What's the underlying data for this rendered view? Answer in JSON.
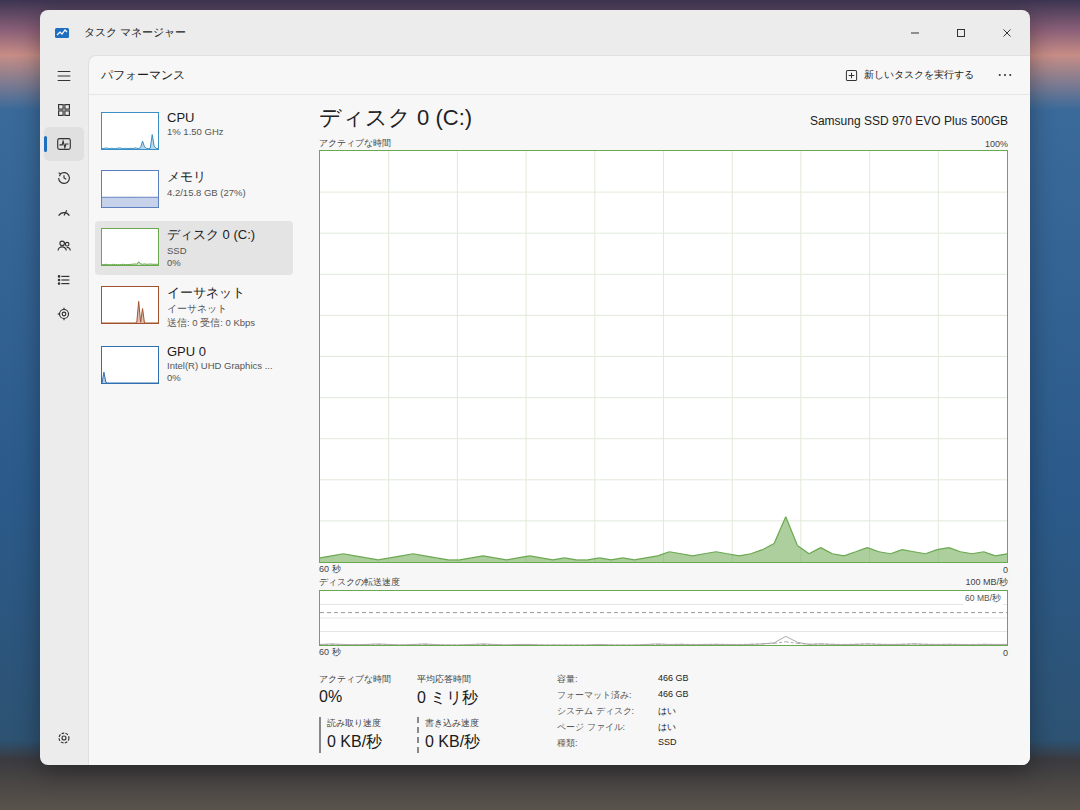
{
  "window": {
    "title": "タスク マネージャー"
  },
  "nav": [
    {
      "kind": "menu",
      "selected": false
    },
    {
      "kind": "processes",
      "selected": false
    },
    {
      "kind": "performance",
      "selected": true
    },
    {
      "kind": "history",
      "selected": false
    },
    {
      "kind": "startup",
      "selected": false
    },
    {
      "kind": "users",
      "selected": false
    },
    {
      "kind": "details",
      "selected": false
    },
    {
      "kind": "services",
      "selected": false
    },
    {
      "kind": "settings",
      "selected": false
    }
  ],
  "header": {
    "title": "パフォーマンス",
    "run_task": "新しいタスクを実行する"
  },
  "devices": [
    {
      "name": "CPU",
      "lines": [
        "1% 1.50 GHz"
      ],
      "selected": false,
      "color": "#3b8fc4",
      "max_value": 100,
      "values": [
        2,
        1,
        3,
        2,
        1,
        2,
        1,
        1,
        2,
        3,
        2,
        1,
        2,
        1,
        1,
        2,
        1,
        3,
        2,
        1,
        4,
        22,
        6,
        2,
        1,
        2,
        40,
        8,
        2,
        1
      ]
    },
    {
      "name": "メモリ",
      "lines": [
        "4.2/15.8 GB (27%)"
      ],
      "selected": false,
      "color": "#5b7fbf",
      "max_value": 100,
      "values": [
        27,
        27,
        27,
        27,
        27,
        27,
        27,
        27,
        27,
        27,
        27,
        27,
        27,
        27,
        27,
        27,
        27,
        27,
        27,
        27,
        27,
        27,
        27,
        27,
        27,
        27,
        27,
        27,
        27,
        27
      ]
    },
    {
      "name": "ディスク 0 (C:)",
      "lines": [
        "SSD",
        "0%"
      ],
      "selected": true,
      "color": "#6aa84f",
      "max_value": 100,
      "values": [
        1,
        1,
        2,
        1,
        1,
        1,
        2,
        1,
        1,
        1,
        1,
        2,
        1,
        1,
        1,
        2,
        2,
        3,
        2,
        9,
        3,
        2,
        3,
        2,
        2,
        3,
        2,
        2,
        2,
        2
      ]
    },
    {
      "name": "イーサネット",
      "lines": [
        "イーサネット",
        "送信: 0 受信: 0 Kbps"
      ],
      "selected": false,
      "color": "#a0522d",
      "max_value": 100,
      "values": [
        0,
        0,
        0,
        0,
        0,
        0,
        0,
        0,
        0,
        0,
        0,
        0,
        0,
        0,
        0,
        0,
        0,
        0,
        1,
        60,
        2,
        40,
        0,
        0,
        0,
        0,
        0,
        0,
        0,
        0
      ]
    },
    {
      "name": "GPU 0",
      "lines": [
        "Intel(R) UHD Graphics ...",
        "0%"
      ],
      "selected": false,
      "color": "#2f6fb0",
      "max_value": 100,
      "values": [
        0,
        30,
        2,
        0,
        0,
        0,
        0,
        0,
        0,
        0,
        0,
        0,
        0,
        0,
        0,
        0,
        0,
        0,
        0,
        0,
        0,
        0,
        0,
        0,
        0,
        0,
        0,
        0,
        0,
        0
      ]
    }
  ],
  "detail": {
    "title": "ディスク 0 (C:)",
    "model": "Samsung SSD 970 EVO Plus 500GB",
    "active_chart": {
      "label": "アクティブな時間",
      "max": "100%",
      "time": "60 秒",
      "min": "0",
      "max_value": 100,
      "values": [
        1,
        1.5,
        2,
        1.5,
        1,
        0.5,
        1,
        1.5,
        2,
        1.5,
        1,
        0.5,
        0.5,
        1,
        1.5,
        1,
        0.5,
        1,
        1.5,
        1,
        0.5,
        1,
        0.5,
        0.5,
        1,
        0.5,
        1,
        0.5,
        1,
        1.5,
        2.5,
        2,
        1.5,
        2,
        2.5,
        2,
        1.5,
        2,
        3,
        4.5,
        11,
        4,
        2,
        3.5,
        2,
        1.5,
        2.5,
        3.5,
        2.5,
        2,
        3,
        2.5,
        2,
        3,
        3.5,
        2.5,
        2,
        2.5,
        1.5,
        2
      ]
    },
    "transfer_chart": {
      "label": "ディスクの転送速度",
      "max": "100 MB/秒",
      "ref": "60 MB/秒",
      "ref_value": 60,
      "time": "60 秒",
      "min": "0",
      "max_value": 100,
      "series": [
        {
          "name": "read",
          "dashed": false,
          "values": [
            1,
            2,
            1,
            0.5,
            1,
            2,
            1,
            0,
            1,
            2,
            0.5,
            0,
            0,
            1,
            2,
            1,
            0,
            1,
            1,
            0,
            0,
            0,
            0,
            0,
            1,
            0,
            0,
            0,
            1,
            2,
            1,
            1,
            0.5,
            1,
            1,
            1,
            0.5,
            1,
            2,
            4,
            16,
            5,
            1,
            2,
            1,
            0.5,
            1,
            2,
            1,
            1,
            1,
            2,
            1,
            1,
            1,
            1,
            0.5,
            1,
            1,
            1
          ]
        },
        {
          "name": "write",
          "dashed": true,
          "values": [
            0.5,
            1,
            0.5,
            0.5,
            1,
            1,
            0.5,
            0,
            0.5,
            1,
            0.5,
            0,
            0,
            0.5,
            1,
            0.5,
            0,
            0.5,
            0.5,
            0,
            0,
            0,
            0,
            0,
            0.5,
            0,
            0,
            0,
            0.5,
            1,
            1,
            1.5,
            1,
            1,
            1.5,
            1,
            1,
            1.5,
            2,
            3,
            6,
            3,
            1.5,
            2,
            1.5,
            1,
            1.5,
            2,
            1.5,
            1,
            1.5,
            2,
            1.5,
            1,
            1.5,
            1,
            1,
            1.5,
            1,
            1
          ]
        }
      ]
    },
    "stats": [
      {
        "label": "アクティブな時間",
        "value": "0%",
        "kind": "plain"
      },
      {
        "label": "平均応答時間",
        "value": "0 ミリ秒",
        "kind": "plain"
      },
      {
        "label": "読み取り速度",
        "value": "0 KB/秒",
        "kind": "solid"
      },
      {
        "label": "書き込み速度",
        "value": "0 KB/秒",
        "kind": "dashed"
      }
    ],
    "properties": [
      {
        "label": "容量:",
        "value": "466 GB"
      },
      {
        "label": "フォーマット済み:",
        "value": "466 GB"
      },
      {
        "label": "システム ディスク:",
        "value": "はい"
      },
      {
        "label": "ページ ファイル:",
        "value": "はい"
      },
      {
        "label": "種類:",
        "value": "SSD"
      }
    ]
  }
}
